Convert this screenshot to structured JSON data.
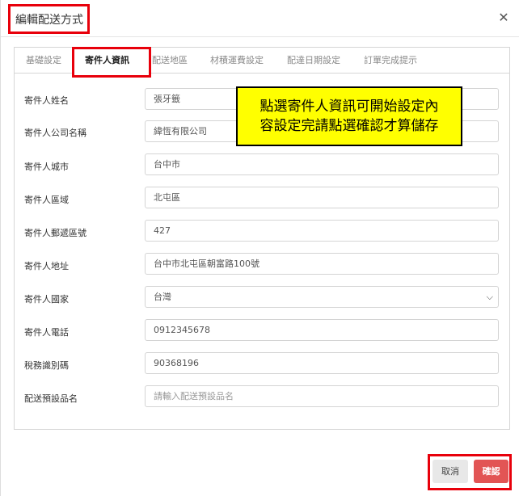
{
  "dialog": {
    "title": "編輯配送方式",
    "close_icon": "close-icon"
  },
  "tabs": [
    {
      "label": "基礎設定",
      "active": false
    },
    {
      "label": "寄件人資訊",
      "active": true
    },
    {
      "label": "配送地區",
      "active": false
    },
    {
      "label": "材積運費設定",
      "active": false
    },
    {
      "label": "配達日期設定",
      "active": false
    },
    {
      "label": "訂單完成提示",
      "active": false
    }
  ],
  "form": {
    "sender_name": {
      "label": "寄件人姓名",
      "value": "張牙籤"
    },
    "sender_company": {
      "label": "寄件人公司名稱",
      "value": "緯恆有限公司"
    },
    "sender_city": {
      "label": "寄件人城市",
      "value": "台中市"
    },
    "sender_district": {
      "label": "寄件人區域",
      "value": "北屯區"
    },
    "sender_postcode": {
      "label": "寄件人郵遞區號",
      "value": "427"
    },
    "sender_address": {
      "label": "寄件人地址",
      "value": "台中市北屯區朝富路100號"
    },
    "sender_country": {
      "label": "寄件人國家",
      "value": "台灣"
    },
    "sender_phone": {
      "label": "寄件人電話",
      "value": "0912345678"
    },
    "tax_id": {
      "label": "稅務識別碼",
      "value": "90368196"
    },
    "default_product": {
      "label": "配送預設品名",
      "placeholder": "請輸入配送預設品名"
    }
  },
  "callout": {
    "line1": "點選寄件人資訊可開始設定內",
    "line2": "容設定完請點選確認才算儲存"
  },
  "footer": {
    "cancel_label": "取消",
    "confirm_label": "確認"
  },
  "colors": {
    "highlight_border": "#e8000b",
    "callout_bg": "#ffff00",
    "confirm_bg": "#e25555"
  }
}
